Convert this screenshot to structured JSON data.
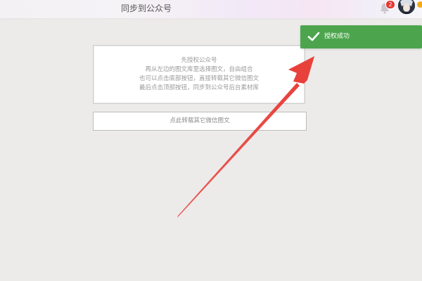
{
  "header": {
    "title": "同步到公众号",
    "notification_count": "2"
  },
  "hint": {
    "lines": [
      "先授权公众号",
      "再从左边的图文库里选择图文，自由组合",
      "也可以点击底部按钮，直接转载其它微信图文",
      "最后点击顶部按钮，同步到公众号后台素材库"
    ]
  },
  "actions": {
    "repost_label": "点此转载其它微信图文"
  },
  "toast": {
    "message": "授权成功",
    "color": "#4ca54d"
  },
  "annotation": {
    "arrow_color": "#e8413c"
  },
  "icons": {
    "bell": "bell-icon",
    "check": "check-icon",
    "avatar": "avatar"
  }
}
